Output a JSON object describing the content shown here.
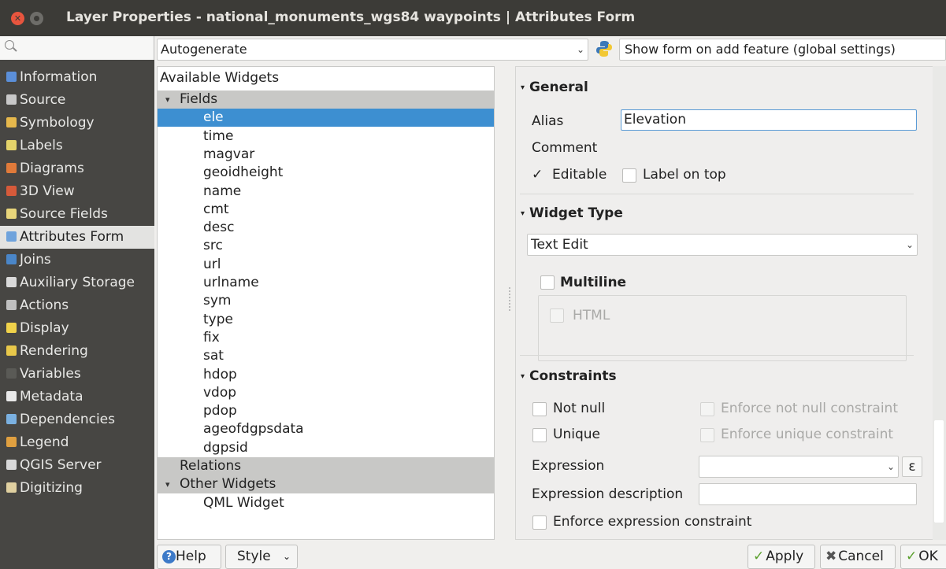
{
  "window": {
    "title": "Layer Properties - national_monuments_wgs84 waypoints | Attributes Form"
  },
  "sidebar": {
    "items": [
      {
        "label": "Information",
        "icon": "info-icon",
        "color": "#5b8fd9"
      },
      {
        "label": "Source",
        "icon": "source-icon",
        "color": "#c8c8c8"
      },
      {
        "label": "Symbology",
        "icon": "symbology-icon",
        "color": "#e6b84c"
      },
      {
        "label": "Labels",
        "icon": "labels-icon",
        "color": "#e3d36a"
      },
      {
        "label": "Diagrams",
        "icon": "diagrams-icon",
        "color": "#e07a3a"
      },
      {
        "label": "3D View",
        "icon": "3d-view-icon",
        "color": "#d65a3a"
      },
      {
        "label": "Source Fields",
        "icon": "source-fields-icon",
        "color": "#e8d57a"
      },
      {
        "label": "Attributes Form",
        "icon": "attributes-form-icon",
        "color": "#6fa3dc"
      },
      {
        "label": "Joins",
        "icon": "joins-icon",
        "color": "#4a86c8"
      },
      {
        "label": "Auxiliary Storage",
        "icon": "auxiliary-storage-icon",
        "color": "#dadada"
      },
      {
        "label": "Actions",
        "icon": "actions-icon",
        "color": "#c0c0c0"
      },
      {
        "label": "Display",
        "icon": "display-icon",
        "color": "#f0d24a"
      },
      {
        "label": "Rendering",
        "icon": "rendering-icon",
        "color": "#e8c84a"
      },
      {
        "label": "Variables",
        "icon": "variables-icon",
        "color": "#5a5a56"
      },
      {
        "label": "Metadata",
        "icon": "metadata-icon",
        "color": "#e8e8e8"
      },
      {
        "label": "Dependencies",
        "icon": "dependencies-icon",
        "color": "#7ab0e0"
      },
      {
        "label": "Legend",
        "icon": "legend-icon",
        "color": "#e0a040"
      },
      {
        "label": "QGIS Server",
        "icon": "qgis-server-icon",
        "color": "#d8d8d8"
      },
      {
        "label": "Digitizing",
        "icon": "digitizing-icon",
        "color": "#e0d0a0"
      }
    ],
    "active_index": 7
  },
  "toolbar": {
    "form_mode": "Autogenerate",
    "show_form_option": "Show form on add feature (global settings)"
  },
  "tree": {
    "header": "Available Widgets",
    "fields_group": "Fields",
    "fields": [
      "ele",
      "time",
      "magvar",
      "geoidheight",
      "name",
      "cmt",
      "desc",
      "src",
      "url",
      "urlname",
      "sym",
      "type",
      "fix",
      "sat",
      "hdop",
      "vdop",
      "pdop",
      "ageofdgpsdata",
      "dgpsid"
    ],
    "selected_field": "ele",
    "relations_group": "Relations",
    "other_group": "Other Widgets",
    "other_items": [
      "QML Widget"
    ]
  },
  "general": {
    "title": "General",
    "alias_label": "Alias",
    "alias_value": "Elevation",
    "comment_label": "Comment",
    "editable_label": "Editable",
    "editable_checked": true,
    "label_on_top_label": "Label on top",
    "label_on_top_checked": false
  },
  "widget_type": {
    "title": "Widget Type",
    "selected": "Text Edit",
    "multiline_label": "Multiline",
    "html_label": "HTML"
  },
  "constraints": {
    "title": "Constraints",
    "not_null_label": "Not null",
    "enforce_not_null_label": "Enforce not null constraint",
    "unique_label": "Unique",
    "enforce_unique_label": "Enforce unique constraint",
    "expression_label": "Expression",
    "expression_value": "",
    "expression_button": "ε",
    "expression_description_label": "Expression description",
    "expression_description_value": "",
    "enforce_expression_label": "Enforce expression constraint"
  },
  "buttons": {
    "help": "Help",
    "style": "Style",
    "apply": "Apply",
    "cancel": "Cancel",
    "ok": "OK"
  }
}
